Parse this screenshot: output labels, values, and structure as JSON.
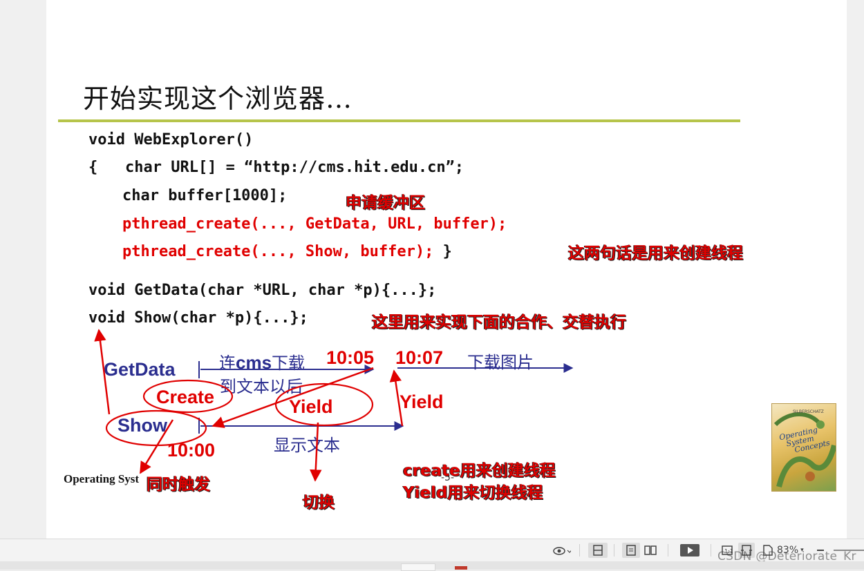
{
  "slide": {
    "title": "开始实现这个浏览器…",
    "code": {
      "line1": "void WebExplorer()",
      "line2": "{   char URL[] = “http://cms.hit.edu.cn”;",
      "line3": "char buffer[1000];",
      "line4": "pthread_create(..., GetData, URL, buffer);",
      "line5_red": "pthread_create(..., Show, buffer);",
      "line5_end": " }",
      "line6": "void GetData(char *URL, char *p){...};",
      "line7": "void Show(char *p){...};"
    },
    "annotations": {
      "buffer": "申请缓冲区",
      "two_lines": "这两句话是用来创建线程",
      "show_note": "这里用来实现下面的合作、交替执行",
      "same_time": "同时触发",
      "switch": "切换",
      "create_note": "create用来创建线程",
      "yield_note": "Yield用来切换线程"
    },
    "diagram": {
      "getdata": "GetData",
      "show": "Show",
      "create": "Create",
      "yield1": "Yield",
      "yield2": "Yield",
      "conn_label_1": "连",
      "conn_label_cms": "cms",
      "conn_label_2": "下载",
      "conn_label_3": "到文本以后",
      "time1005": "10:05",
      "time1007": "10:07",
      "download_img": "下载图片",
      "show_text": "显示文本",
      "time1000": "10:00"
    },
    "footer": {
      "course": "Operating Syst",
      "page": "-5-"
    },
    "book": {
      "title_1": "Operating",
      "title_2": "System",
      "title_3": "Concepts"
    }
  },
  "statusbar": {
    "zoom": "83%",
    "watermark": "CSDN @Deteriorate_Kr"
  },
  "colors": {
    "accent_rule": "#b6c44a",
    "red": "#e00000",
    "blue": "#2b2e8f"
  }
}
